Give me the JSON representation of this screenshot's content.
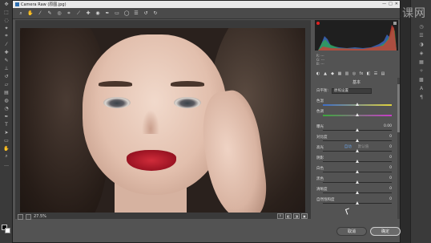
{
  "dialog": {
    "title": "Camera Raw (原图.jpg)",
    "title_controls": [
      "—",
      "□",
      "✕"
    ]
  },
  "toolbar": {
    "tools": [
      "zoom-icon",
      "hand-icon",
      "white-balance-icon",
      "color-sampler-icon",
      "targeted-adjustment-icon",
      "crop-icon",
      "straighten-icon",
      "spot-removal-icon",
      "red-eye-icon",
      "adjustment-brush-icon",
      "graduated-filter-icon",
      "radial-filter-icon",
      "preferences-icon",
      "rotate-left-icon",
      "rotate-right-icon"
    ]
  },
  "canvas": {
    "zoom_label": "27.5%",
    "view_buttons": [
      "Y",
      "◧",
      "◨",
      "▣"
    ]
  },
  "panel": {
    "readout": {
      "r": "R: ---",
      "g": "G: ---",
      "b": "B: ---"
    },
    "section_title": "基本",
    "white_balance": {
      "label": "白平衡:",
      "value": "原照设置"
    },
    "auto_label": "自动",
    "default_label": "默认值",
    "sliders": [
      {
        "label": "色温",
        "value": "",
        "pos": 0.5,
        "track": "temp"
      },
      {
        "label": "色调",
        "value": "",
        "pos": 0.5,
        "track": "tint"
      },
      {
        "label": "曝光",
        "value": "0.00",
        "pos": 0.5,
        "track": "plain"
      },
      {
        "label": "对比度",
        "value": "0",
        "pos": 0.5,
        "track": "plain"
      },
      {
        "label": "高光",
        "value": "0",
        "pos": 0.5,
        "track": "plain"
      },
      {
        "label": "阴影",
        "value": "0",
        "pos": 0.5,
        "track": "plain"
      },
      {
        "label": "白色",
        "value": "0",
        "pos": 0.5,
        "track": "plain"
      },
      {
        "label": "黑色",
        "value": "0",
        "pos": 0.5,
        "track": "plain"
      },
      {
        "label": "清晰度",
        "value": "0",
        "pos": 0.5,
        "track": "plain"
      },
      {
        "label": "自然饱和度",
        "value": "0",
        "pos": 0.5,
        "track": "plain"
      }
    ]
  },
  "footer": {
    "cancel_label": "取消",
    "ok_label": "确定"
  },
  "watermark": {
    "text": "虎课网"
  }
}
